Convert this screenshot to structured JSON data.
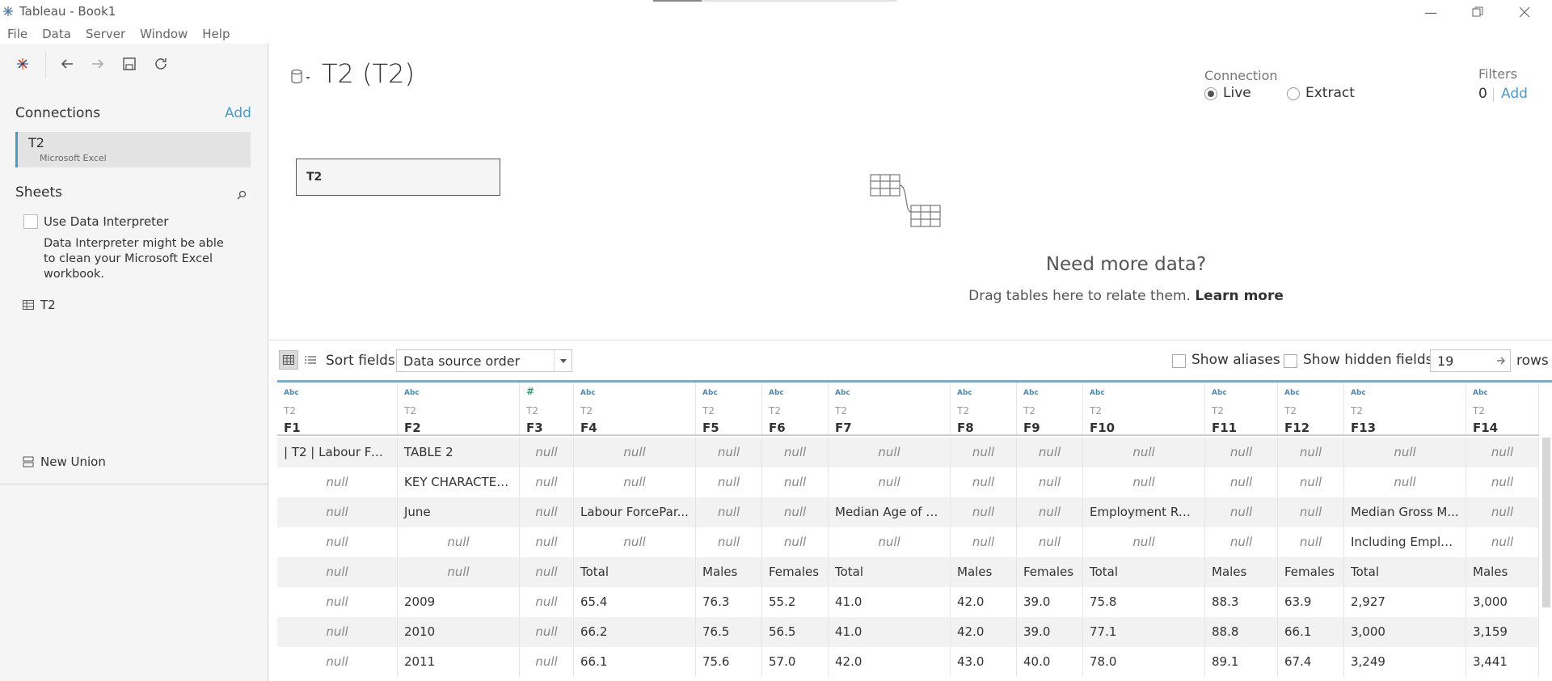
{
  "window": {
    "title": "Tableau - Book1"
  },
  "menu": [
    "File",
    "Data",
    "Server",
    "Window",
    "Help"
  ],
  "left_panel": {
    "connections_title": "Connections",
    "add_label": "Add",
    "connection": {
      "name": "T2",
      "type": "Microsoft Excel"
    },
    "sheets_title": "Sheets",
    "data_interpreter_label": "Use Data Interpreter",
    "data_interpreter_desc": "Data Interpreter might be able to clean your Microsoft Excel workbook.",
    "sheet_item": "T2",
    "new_union": "New Union"
  },
  "datasource": {
    "title": "T2 (T2)",
    "connection_label": "Connection",
    "live_label": "Live",
    "extract_label": "Extract",
    "filters_label": "Filters",
    "filters_count": "0",
    "filters_add": "Add",
    "table_name": "T2",
    "need_more": "Need more data?",
    "drag_text": "Drag tables here to relate them.",
    "learn_more": "Learn more"
  },
  "grid_toolbar": {
    "sort_label": "Sort fields",
    "sort_value": "Data source order",
    "show_aliases": "Show aliases",
    "show_hidden": "Show hidden fields",
    "rows_value": "19",
    "rows_label": "rows"
  },
  "grid": {
    "columns": [
      {
        "type": "Abc",
        "src": "T2",
        "name": "F1"
      },
      {
        "type": "Abc",
        "src": "T2",
        "name": "F2"
      },
      {
        "type": "#",
        "src": "T2",
        "name": "F3"
      },
      {
        "type": "Abc",
        "src": "T2",
        "name": "F4"
      },
      {
        "type": "Abc",
        "src": "T2",
        "name": "F5"
      },
      {
        "type": "Abc",
        "src": "T2",
        "name": "F6"
      },
      {
        "type": "Abc",
        "src": "T2",
        "name": "F7"
      },
      {
        "type": "Abc",
        "src": "T2",
        "name": "F8"
      },
      {
        "type": "Abc",
        "src": "T2",
        "name": "F9"
      },
      {
        "type": "Abc",
        "src": "T2",
        "name": "F10"
      },
      {
        "type": "Abc",
        "src": "T2",
        "name": "F11"
      },
      {
        "type": "Abc",
        "src": "T2",
        "name": "F12"
      },
      {
        "type": "Abc",
        "src": "T2",
        "name": "F13"
      },
      {
        "type": "Abc",
        "src": "T2",
        "name": "F14"
      }
    ],
    "rows": [
      [
        "| T2 | Labour Forc...",
        "TABLE 2",
        "null",
        "null",
        "null",
        "null",
        "null",
        "null",
        "null",
        "null",
        "null",
        "null",
        "null",
        "null"
      ],
      [
        "null",
        "KEY CHARACTER...",
        "null",
        "null",
        "null",
        "null",
        "null",
        "null",
        "null",
        "null",
        "null",
        "null",
        "null",
        "null"
      ],
      [
        "null",
        "June",
        "null",
        "Labour ForcePar...",
        "null",
        "null",
        "Median Age of L...",
        "null",
        "null",
        "Employment Rat...",
        "null",
        "null",
        "Median Gross M...",
        "null"
      ],
      [
        "null",
        "null",
        "null",
        "null",
        "null",
        "null",
        "null",
        "null",
        "null",
        "null",
        "null",
        "null",
        "Including Employ...",
        "null"
      ],
      [
        "null",
        "null",
        "null",
        "Total",
        "Males",
        "Females",
        "Total",
        "Males",
        "Females",
        "Total",
        "Males",
        "Females",
        "Total",
        "Males"
      ],
      [
        "null",
        "2009",
        "null",
        "65.4",
        "76.3",
        "55.2",
        "41.0",
        "42.0",
        "39.0",
        "75.8",
        "88.3",
        "63.9",
        "2,927",
        "3,000"
      ],
      [
        "null",
        "2010",
        "null",
        "66.2",
        "76.5",
        "56.5",
        "41.0",
        "42.0",
        "39.0",
        "77.1",
        "88.8",
        "66.1",
        "3,000",
        "3,159"
      ],
      [
        "null",
        "2011",
        "null",
        "66.1",
        "75.6",
        "57.0",
        "42.0",
        "43.0",
        "40.0",
        "78.0",
        "89.1",
        "67.4",
        "3,249",
        "3,441"
      ]
    ]
  }
}
